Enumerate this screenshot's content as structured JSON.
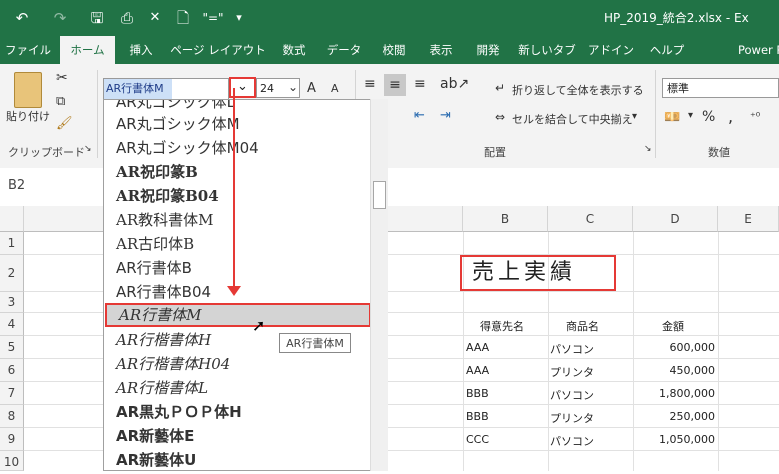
{
  "titlebar": {
    "undo": "↶",
    "redo": "↷",
    "save": "🖫",
    "preview": "⎙",
    "close": "✕",
    "newdoc": "🗋",
    "quote": "\"=\"",
    "more": "▾",
    "title": "HP_2019_統合2.xlsx - Ex"
  },
  "tabs": [
    "ファイル",
    "ホーム",
    "挿入",
    "ページ レイアウト",
    "数式",
    "データ",
    "校閲",
    "表示",
    "開発",
    "新しいタブ",
    "アドイン",
    "ヘルプ",
    "Power P"
  ],
  "ribbon": {
    "paste_label": "貼り付け",
    "clipboard_label": "クリップボード",
    "font_name": "AR行書体M",
    "font_size": "24",
    "grow_font": "A",
    "shrink_font": "A",
    "wrap_text": "折り返して全体を表示する",
    "merge_center": "セルを結合して中央揃え",
    "alignment_label": "配置",
    "number_format": "標準",
    "percent": "%",
    "comma": ",",
    "number_label": "数値"
  },
  "namebox": "B2",
  "columns": [
    "B",
    "C",
    "D",
    "E"
  ],
  "rows": [
    "1",
    "2",
    "3",
    "4",
    "5",
    "6",
    "7",
    "8",
    "9",
    "10"
  ],
  "sheet": {
    "title_cell": "売上実績",
    "headers": [
      "得意先名",
      "商品名",
      "金額"
    ],
    "data": [
      [
        "AAA",
        "パソコン",
        "600,000"
      ],
      [
        "AAA",
        "プリンタ",
        "450,000"
      ],
      [
        "BBB",
        "パソコン",
        "1,800,000"
      ],
      [
        "BBB",
        "プリンタ",
        "250,000"
      ],
      [
        "CCC",
        "パソコン",
        "1,050,000"
      ]
    ]
  },
  "font_list": [
    "AR丸ゴシック体L",
    "AR丸ゴシック体M",
    "AR丸ゴシック体M04",
    "AR祝印篆B",
    "AR祝印篆B04",
    "AR教科書体M",
    "AR古印体B",
    "AR行書体B",
    "AR行書体B04",
    "AR行書体M",
    "AR行楷書体H",
    "AR行楷書体H04",
    "AR行楷書体L",
    "AR黒丸ＰＯＰ体H",
    "AR新藝体E",
    "AR新藝体U"
  ],
  "tooltip": "AR行書体M",
  "colors": {
    "excel_green": "#217346",
    "highlight_red": "#e53935"
  }
}
